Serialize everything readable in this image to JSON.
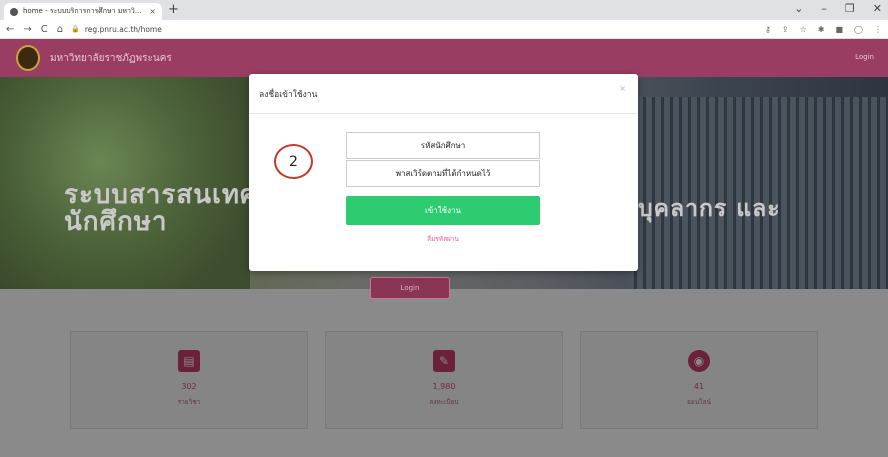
{
  "browser": {
    "tab_title": "home - ระบบบริการการศึกษา มหาวิ...",
    "tab_close": "×",
    "new_tab": "+",
    "url": "reg.pnru.ac.th/home",
    "nav": {
      "back": "←",
      "forward": "→",
      "reload": "C",
      "home": "⌂"
    },
    "window": {
      "collapse": "⌄",
      "minimize": "–",
      "restore": "❐",
      "close": "✕"
    },
    "extensions": [
      "⚷",
      "⇪",
      "☆",
      "✱",
      "■",
      "◯",
      "⋮"
    ]
  },
  "site": {
    "university_name": "มหาวิทยาลัยราชภัฏพระนคร",
    "login_link": "Login",
    "hero_left": "ระบบสารสนเทศ นักศึกษา",
    "hero_right": "บุคลากร และ",
    "cta": "Login"
  },
  "stats": [
    {
      "icon": "book-icon",
      "glyph": "▤",
      "value": "302",
      "label": "รายวิชา"
    },
    {
      "icon": "edit-icon",
      "glyph": "✎",
      "value": "1,980",
      "label": "ลงทะเบียน"
    },
    {
      "icon": "globe-icon",
      "glyph": "◉",
      "value": "41",
      "label": "ออนไลน์"
    }
  ],
  "modal": {
    "title": "ลงชื่อเข้าใช้งาน",
    "close": "×",
    "student_id_placeholder": "รหัสนักศึกษา",
    "password_placeholder": "พาสเวิร์ดตามที่ได้กำหนดไว้",
    "enter_button": "เข้าใช้งาน",
    "forgot_link": "ลืมรหัสผ่าน",
    "step_marker": "2"
  }
}
